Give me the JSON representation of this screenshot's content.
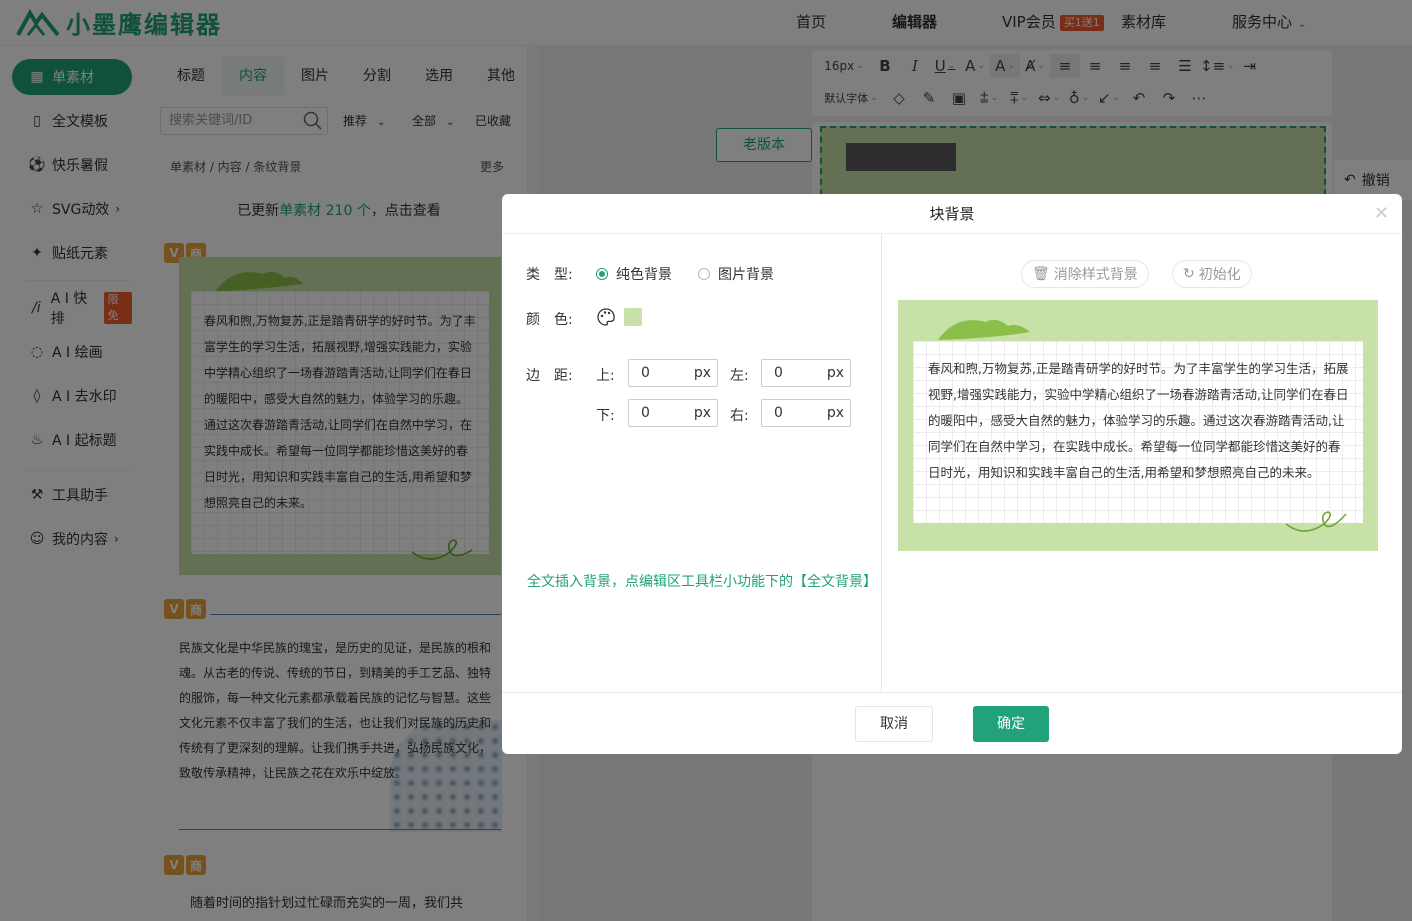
{
  "app": {
    "logo_text": "小墨鹰编辑器"
  },
  "nav": {
    "items": [
      "首页",
      "编辑器",
      "VIP会员",
      "素材库",
      "服务中心"
    ],
    "vip_badge": "买1送1"
  },
  "sidebar": {
    "items": [
      {
        "label": "单素材",
        "icon": "grid-icon"
      },
      {
        "label": "全文模板",
        "icon": "template-icon"
      },
      {
        "label": "快乐暑假",
        "icon": "ball-icon"
      },
      {
        "label": "SVG动效",
        "icon": "star-icon"
      },
      {
        "label": "贴纸元素",
        "icon": "puzzle-icon"
      },
      {
        "label": "A I 快排",
        "icon": "ai-icon",
        "badge": "限免"
      },
      {
        "label": "A I 绘画",
        "icon": "chat-icon"
      },
      {
        "label": "A I 去水印",
        "icon": "drop-icon"
      },
      {
        "label": "A I 起标题",
        "icon": "fire-icon"
      },
      {
        "label": "工具助手",
        "icon": "tools-icon"
      },
      {
        "label": "我的内容",
        "icon": "user-icon"
      }
    ]
  },
  "material": {
    "tabs": [
      "标题",
      "内容",
      "图片",
      "分割",
      "选用",
      "其他"
    ],
    "active_tab": "内容",
    "search_placeholder": "搜索关键词/ID",
    "filters": [
      "推荐",
      "全部",
      "已收藏"
    ],
    "breadcrumb": "单素材 / 内容 / 条纹背景",
    "more": "更多",
    "update_prefix": "已更新",
    "update_highlight": "单素材 210 个",
    "update_suffix": "，点击查看",
    "tag_v": "V",
    "tag_shang": "商",
    "card1_text": "春风和煦,万物复苏,正是踏青研学的好时节。为了丰富学生的学习生活，拓展视野,增强实践能力，实验中学精心组织了一场春游踏青活动,让同学们在春日的暖阳中，感受大自然的魅力，体验学习的乐趣。通过这次春游踏青活动,让同学们在自然中学习，在实践中成长。希望每一位同学都能珍惜这美好的春日时光，用知识和实践丰富自己的生活,用希望和梦想照亮自己的未来。",
    "card2_text": "民族文化是中华民族的瑰宝，是历史的见证，是民族的根和魂。从古老的传说、传统的节日，到精美的手工艺品、独特的服饰，每一种文化元素都承载着民族的记忆与智慧。这些文化元素不仅丰富了我们的生活，也让我们对民族的历史和传统有了更深刻的理解。让我们携手共进，弘扬民族文化，致敬传承精神，让民族之花在欢乐中绽放。",
    "card3_text": "随着时间的指针划过忙碌而充实的一周，我们共"
  },
  "editor": {
    "font_size": "16px",
    "default_font": "默认字体",
    "old_version": "老版本",
    "undo": "撤销"
  },
  "dialog": {
    "title": "块背景",
    "type_label": "类　型:",
    "type_options": [
      "纯色背景",
      "图片背景"
    ],
    "type_selected": "纯色背景",
    "color_label": "颜　色:",
    "color_value": "#c7e1a9",
    "margin_label": "边　距:",
    "top_label": "上:",
    "left_label": "左:",
    "bottom_label": "下:",
    "right_label": "右:",
    "top_value": "0",
    "left_value": "0",
    "bottom_value": "0",
    "right_value": "0",
    "unit": "px",
    "hint": "全文插入背景，点编辑区工具栏小功能下的【全文背景】",
    "clear_style": "消除样式背景",
    "init": "初始化",
    "preview_text": "春风和煦,万物复苏,正是踏青研学的好时节。为了丰富学生的学习生活，拓展视野,增强实践能力，实验中学精心组织了一场春游踏青活动,让同学们在春日的暖阳中，感受大自然的魅力，体验学习的乐趣。通过这次春游踏青活动,让同学们在自然中学习，在实践中成长。希望每一位同学都能珍惜这美好的春日时光，用知识和实践丰富自己的生活,用希望和梦想照亮自己的未来。",
    "cancel": "取消",
    "ok": "确定"
  },
  "colors": {
    "accent": "#21a27a",
    "badge": "#f25d2c",
    "block_bg": "#c7e1a9"
  }
}
